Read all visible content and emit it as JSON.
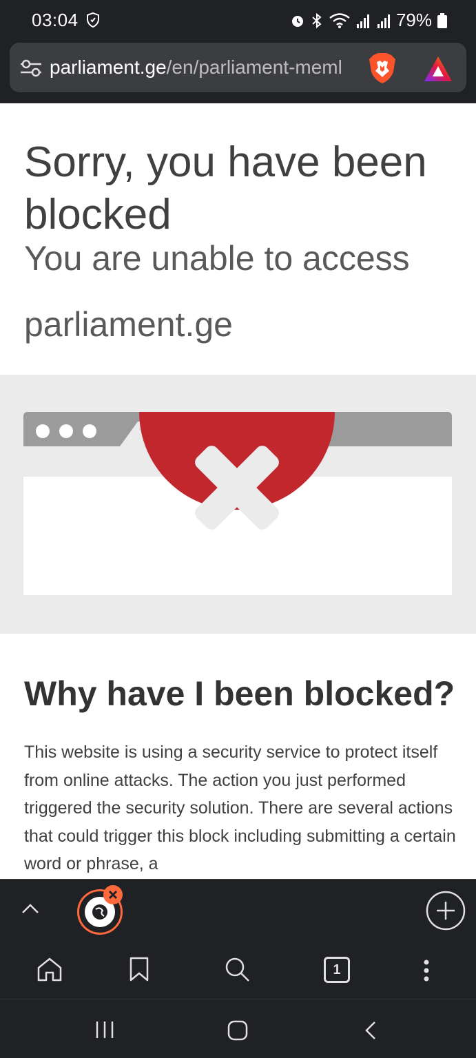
{
  "status_bar": {
    "time": "03:04",
    "battery": "79%",
    "icons": [
      "shield-icon",
      "alarm-icon",
      "bluetooth-icon",
      "wifi-icon",
      "signal-icon",
      "signal-icon-2",
      "battery-icon"
    ]
  },
  "address_bar": {
    "url_domain": "parliament.ge",
    "url_path": "/en/parliament-meml",
    "icons": [
      "tune-icon",
      "brave-shields-icon",
      "brave-rewards-icon"
    ]
  },
  "page": {
    "title": "Sorry, you have been blocked",
    "subtitle_line1": "You are unable to access",
    "subtitle_line2": "parliament.ge",
    "why_title": "Why have I been blocked?",
    "why_body": "This website is using a security service to protect itself from online attacks. The action you just performed triggered the security solution. There are several actions that could trigger this block including submitting a certain word or phrase, a"
  },
  "bottom_bar": {
    "tab_count": "1",
    "icons": [
      "chevron-up-icon",
      "sidebar-toggle-icon",
      "close-icon",
      "plus-icon",
      "home-icon",
      "bookmark-icon",
      "search-icon",
      "tabs-icon",
      "more-icon"
    ]
  },
  "system_nav": {
    "icons": [
      "recents-icon",
      "home-icon",
      "back-icon"
    ]
  },
  "colors": {
    "dark_bg": "#202124",
    "block_red": "#c1272d",
    "illustration_bg": "#ebebeb",
    "brave_orange": "#ff6a3d"
  }
}
